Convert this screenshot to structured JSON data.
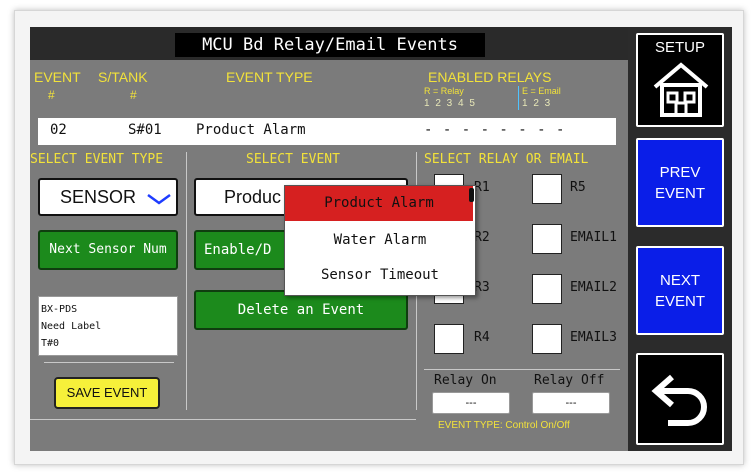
{
  "title": "MCU Bd Relay/Email Events",
  "header": {
    "event": "EVENT",
    "event_hash": "#",
    "stank": "S/TANK",
    "stank_hash": "#",
    "event_type": "EVENT TYPE",
    "enabled_relays": "ENABLED RELAYS",
    "r_legend": "R = Relay",
    "e_legend": "E = Email",
    "r_nums": "1  2  3  4  5",
    "e_nums": "1  2  3"
  },
  "event_row": {
    "num": "02",
    "tank": "S#01",
    "type": "Product Alarm",
    "relays": "- - - - - - - -"
  },
  "left_panel": {
    "header": "SELECT EVENT TYPE",
    "type_value": "SENSOR",
    "next_sensor": "Next Sensor Num",
    "info_lines": [
      "BX-PDS",
      "Need Label",
      "T#0"
    ],
    "save": "SAVE EVENT"
  },
  "middle_panel": {
    "header": "SELECT EVENT",
    "select_value": "Produc",
    "enable_btn": "Enable/D",
    "delete_btn": "Delete an Event"
  },
  "dropdown": {
    "items": [
      "Product Alarm",
      "Water Alarm",
      "Sensor Timeout"
    ],
    "selected": "Product Alarm"
  },
  "right_panel": {
    "header": "SELECT RELAY OR EMAIL",
    "left_col": [
      "R1",
      "R2",
      "R3",
      "R4"
    ],
    "right_col": [
      "R5",
      "EMAIL1",
      "EMAIL2",
      "EMAIL3"
    ],
    "relay_on_label": "Relay On",
    "relay_off_label": "Relay Off",
    "relay_on_value": "---",
    "relay_off_value": "---",
    "event_type_note": "EVENT TYPE: Control On/Off"
  },
  "sidebar": {
    "setup": "SETUP",
    "prev": [
      "PREV",
      "EVENT"
    ],
    "next": [
      "NEXT",
      "EVENT"
    ]
  },
  "colors": {
    "accent_yellow": "#f2e23a",
    "button_green": "#1c8a1c",
    "button_blue": "#0a1ee8",
    "dropdown_selected": "#d62020"
  }
}
